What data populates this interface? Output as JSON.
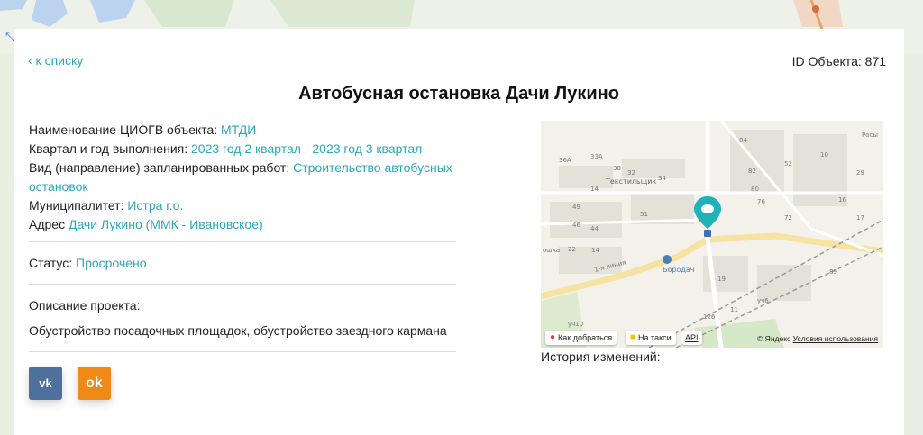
{
  "back_link": "‹ к списку",
  "object_id": "ID Объекта: 871",
  "title": "Автобусная остановка Дачи Лукино",
  "fields": [
    {
      "label": "Наименование ЦИОГВ объекта: ",
      "value": "МТДИ"
    },
    {
      "label": "Квартал и год выполнения: ",
      "value": "2023 год 2 квартал - 2023 год 3 квартал"
    },
    {
      "label": "Вид (направление) запланированных работ: ",
      "value": "Строительство автобусных остановок"
    },
    {
      "label": "Муниципалитет: ",
      "value": "Истра г.о."
    },
    {
      "label": "Адрес ",
      "value": "Дачи Лукино (ММК - Ивановское)"
    }
  ],
  "status": {
    "label": "Статус: ",
    "value": "Просрочено"
  },
  "description": {
    "label": "Описание проекта:",
    "text": "Обустройство посадочных площадок, обустройство заездного кармана"
  },
  "share": {
    "vk": "vk",
    "ok": "ok"
  },
  "map": {
    "labels": [
      "Росы",
      "84",
      "82",
      "80",
      "76",
      "72",
      "36А",
      "33А",
      "30",
      "32",
      "34",
      "Текстильщик",
      "14",
      "51",
      "49",
      "46",
      "44",
      "22",
      "14",
      "ошка",
      "1-я линия",
      "Бородач",
      "уч6",
      "126",
      "11",
      "уч10",
      "19",
      "89",
      "29",
      "10",
      "52",
      "16",
      "17"
    ],
    "route_button": "Как добраться",
    "taxi_button": "На такси",
    "api_link": "API",
    "copyright": "© Яндекс",
    "terms": "Условия использования"
  },
  "history_label": "История изменений:",
  "colors": {
    "accent": "#2aa8b8",
    "marker": "#1fb3b8",
    "vk": "#4f6f9c",
    "ok": "#f08a17"
  }
}
